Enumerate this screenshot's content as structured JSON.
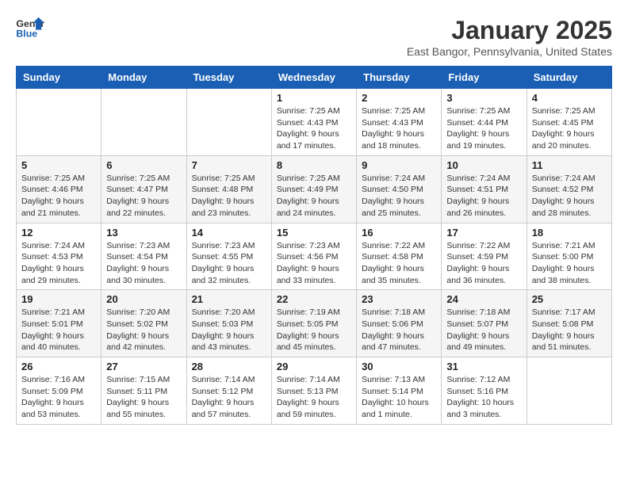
{
  "logo": {
    "line1": "General",
    "line2": "Blue"
  },
  "title": "January 2025",
  "subtitle": "East Bangor, Pennsylvania, United States",
  "weekdays": [
    "Sunday",
    "Monday",
    "Tuesday",
    "Wednesday",
    "Thursday",
    "Friday",
    "Saturday"
  ],
  "weeks": [
    [
      {
        "day": "",
        "info": ""
      },
      {
        "day": "",
        "info": ""
      },
      {
        "day": "",
        "info": ""
      },
      {
        "day": "1",
        "info": "Sunrise: 7:25 AM\nSunset: 4:43 PM\nDaylight: 9 hours\nand 17 minutes."
      },
      {
        "day": "2",
        "info": "Sunrise: 7:25 AM\nSunset: 4:43 PM\nDaylight: 9 hours\nand 18 minutes."
      },
      {
        "day": "3",
        "info": "Sunrise: 7:25 AM\nSunset: 4:44 PM\nDaylight: 9 hours\nand 19 minutes."
      },
      {
        "day": "4",
        "info": "Sunrise: 7:25 AM\nSunset: 4:45 PM\nDaylight: 9 hours\nand 20 minutes."
      }
    ],
    [
      {
        "day": "5",
        "info": "Sunrise: 7:25 AM\nSunset: 4:46 PM\nDaylight: 9 hours\nand 21 minutes."
      },
      {
        "day": "6",
        "info": "Sunrise: 7:25 AM\nSunset: 4:47 PM\nDaylight: 9 hours\nand 22 minutes."
      },
      {
        "day": "7",
        "info": "Sunrise: 7:25 AM\nSunset: 4:48 PM\nDaylight: 9 hours\nand 23 minutes."
      },
      {
        "day": "8",
        "info": "Sunrise: 7:25 AM\nSunset: 4:49 PM\nDaylight: 9 hours\nand 24 minutes."
      },
      {
        "day": "9",
        "info": "Sunrise: 7:24 AM\nSunset: 4:50 PM\nDaylight: 9 hours\nand 25 minutes."
      },
      {
        "day": "10",
        "info": "Sunrise: 7:24 AM\nSunset: 4:51 PM\nDaylight: 9 hours\nand 26 minutes."
      },
      {
        "day": "11",
        "info": "Sunrise: 7:24 AM\nSunset: 4:52 PM\nDaylight: 9 hours\nand 28 minutes."
      }
    ],
    [
      {
        "day": "12",
        "info": "Sunrise: 7:24 AM\nSunset: 4:53 PM\nDaylight: 9 hours\nand 29 minutes."
      },
      {
        "day": "13",
        "info": "Sunrise: 7:23 AM\nSunset: 4:54 PM\nDaylight: 9 hours\nand 30 minutes."
      },
      {
        "day": "14",
        "info": "Sunrise: 7:23 AM\nSunset: 4:55 PM\nDaylight: 9 hours\nand 32 minutes."
      },
      {
        "day": "15",
        "info": "Sunrise: 7:23 AM\nSunset: 4:56 PM\nDaylight: 9 hours\nand 33 minutes."
      },
      {
        "day": "16",
        "info": "Sunrise: 7:22 AM\nSunset: 4:58 PM\nDaylight: 9 hours\nand 35 minutes."
      },
      {
        "day": "17",
        "info": "Sunrise: 7:22 AM\nSunset: 4:59 PM\nDaylight: 9 hours\nand 36 minutes."
      },
      {
        "day": "18",
        "info": "Sunrise: 7:21 AM\nSunset: 5:00 PM\nDaylight: 9 hours\nand 38 minutes."
      }
    ],
    [
      {
        "day": "19",
        "info": "Sunrise: 7:21 AM\nSunset: 5:01 PM\nDaylight: 9 hours\nand 40 minutes."
      },
      {
        "day": "20",
        "info": "Sunrise: 7:20 AM\nSunset: 5:02 PM\nDaylight: 9 hours\nand 42 minutes."
      },
      {
        "day": "21",
        "info": "Sunrise: 7:20 AM\nSunset: 5:03 PM\nDaylight: 9 hours\nand 43 minutes."
      },
      {
        "day": "22",
        "info": "Sunrise: 7:19 AM\nSunset: 5:05 PM\nDaylight: 9 hours\nand 45 minutes."
      },
      {
        "day": "23",
        "info": "Sunrise: 7:18 AM\nSunset: 5:06 PM\nDaylight: 9 hours\nand 47 minutes."
      },
      {
        "day": "24",
        "info": "Sunrise: 7:18 AM\nSunset: 5:07 PM\nDaylight: 9 hours\nand 49 minutes."
      },
      {
        "day": "25",
        "info": "Sunrise: 7:17 AM\nSunset: 5:08 PM\nDaylight: 9 hours\nand 51 minutes."
      }
    ],
    [
      {
        "day": "26",
        "info": "Sunrise: 7:16 AM\nSunset: 5:09 PM\nDaylight: 9 hours\nand 53 minutes."
      },
      {
        "day": "27",
        "info": "Sunrise: 7:15 AM\nSunset: 5:11 PM\nDaylight: 9 hours\nand 55 minutes."
      },
      {
        "day": "28",
        "info": "Sunrise: 7:14 AM\nSunset: 5:12 PM\nDaylight: 9 hours\nand 57 minutes."
      },
      {
        "day": "29",
        "info": "Sunrise: 7:14 AM\nSunset: 5:13 PM\nDaylight: 9 hours\nand 59 minutes."
      },
      {
        "day": "30",
        "info": "Sunrise: 7:13 AM\nSunset: 5:14 PM\nDaylight: 10 hours\nand 1 minute."
      },
      {
        "day": "31",
        "info": "Sunrise: 7:12 AM\nSunset: 5:16 PM\nDaylight: 10 hours\nand 3 minutes."
      },
      {
        "day": "",
        "info": ""
      }
    ]
  ]
}
